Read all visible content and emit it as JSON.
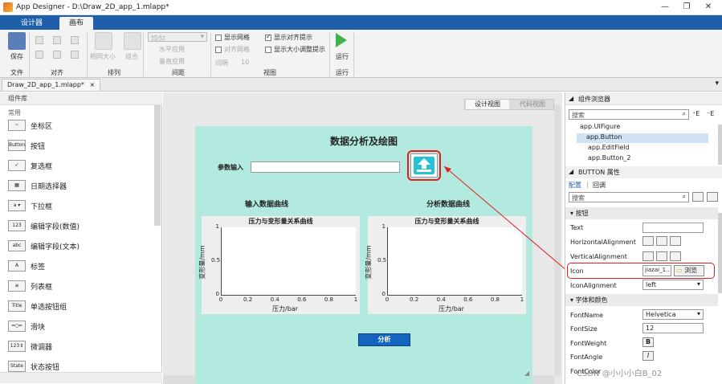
{
  "window": {
    "title": "App Designer - D:\\Draw_2D_app_1.mlapp*"
  },
  "tabs": [
    "设计器",
    "画布"
  ],
  "ribbon": {
    "file": {
      "save": "保存",
      "label": "文件"
    },
    "align": {
      "label": "对齐"
    },
    "arrange": {
      "same_size": "相同大小",
      "group": "组合",
      "label": "排列"
    },
    "spacing": {
      "dropdown": "均匀",
      "horiz": "水平应用",
      "vert": "垂直应用",
      "gap_label": "间隔",
      "gap_value": "10",
      "label": "间距"
    },
    "view": {
      "show_grid": "显示网格",
      "align_to_grid": "对齐网格",
      "show_align_hints": "显示对齐提示",
      "show_resize_hints": "显示大小调整提示",
      "label": "视图"
    },
    "run": {
      "run": "运行",
      "label": "运行"
    }
  },
  "file_tab": "Draw_2D_app_1.mlapp*",
  "library": {
    "title": "组件库",
    "section": "常用",
    "items": [
      {
        "icon": "~",
        "label": "坐标区"
      },
      {
        "icon": "Button",
        "label": "按钮"
      },
      {
        "icon": "✓",
        "label": "复选框"
      },
      {
        "icon": "▦",
        "label": "日期选择器"
      },
      {
        "icon": "a ▾",
        "label": "下拉框"
      },
      {
        "icon": "123",
        "label": "编辑字段(数值)"
      },
      {
        "icon": "abc",
        "label": "编辑字段(文本)"
      },
      {
        "icon": "A",
        "label": "标签"
      },
      {
        "icon": "≡",
        "label": "列表框"
      },
      {
        "icon": "Title",
        "label": "单选按钮组"
      },
      {
        "icon": "━○━",
        "label": "滑块"
      },
      {
        "icon": "123⇕",
        "label": "微调器"
      },
      {
        "icon": "State",
        "label": "状态按钮"
      }
    ]
  },
  "view_toggle": {
    "design": "设计视图",
    "code": "代码视图"
  },
  "figure": {
    "title": "数据分析及绘图",
    "param_label": "参数输入",
    "left_heading": "输入数据曲线",
    "right_heading": "分析数据曲线",
    "analyze_button": "分析"
  },
  "axes": [
    {
      "title": "压力与变形量关系曲线",
      "xlabel": "压力/bar",
      "ylabel": "变形量/mm",
      "xticks": [
        "0",
        "0.2",
        "0.4",
        "0.6",
        "0.8",
        "1"
      ],
      "yticks": [
        "0",
        "0.5",
        "1"
      ]
    },
    {
      "title": "压力与变形量关系曲线",
      "xlabel": "压力/bar",
      "ylabel": "变形量/mm",
      "xticks": [
        "0",
        "0.2",
        "0.4",
        "0.6",
        "0.8",
        "1"
      ],
      "yticks": [
        "0",
        "0.5",
        "1"
      ]
    }
  ],
  "browser": {
    "title": "组件浏览器",
    "search": "搜索",
    "nodes": [
      "app.UIFigure",
      "app.Button",
      "app.EditField",
      "app.Button_2"
    ]
  },
  "props": {
    "title": "BUTTON 属性",
    "tabs": [
      "配置",
      "回调"
    ],
    "search": "搜索",
    "sec_button": "按钮",
    "text_label": "Text",
    "halign": "HorizontalAlignment",
    "valign": "VerticalAlignment",
    "icon_label": "Icon",
    "icon_value": "jiazai_1..",
    "browse": "浏览",
    "icon_align": "IconAlignment",
    "icon_align_value": "left",
    "sec_font": "字体和颜色",
    "font_name": "FontName",
    "font_name_value": "Helvetica",
    "font_size": "FontSize",
    "font_size_value": "12",
    "font_weight": "FontWeight",
    "font_angle": "FontAngle",
    "font_color": "FontColor"
  },
  "watermark": "CSDN @小小小白B_02",
  "colors": {
    "accent": "#1f5ea8",
    "figure_bg": "#b3eadf",
    "annotation": "#e02020",
    "button": "#1565c0",
    "upload_icon": "#27c4d8"
  }
}
